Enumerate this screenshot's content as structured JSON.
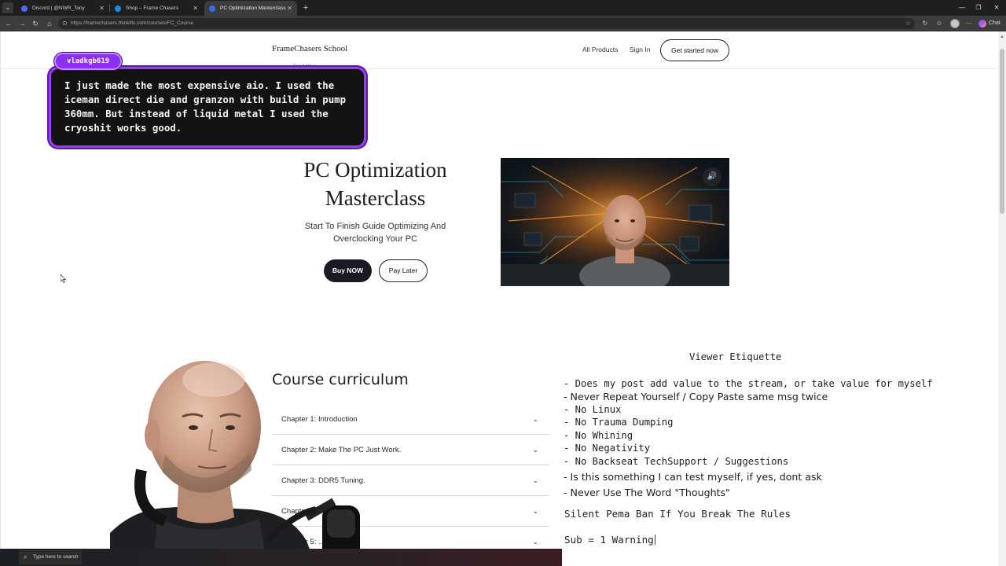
{
  "browser": {
    "tabs": [
      {
        "title": "Discord | @NWR_Tony",
        "favicon_color": "#5865F2"
      },
      {
        "title": "Shop – Frame Chasers",
        "favicon_color": "#1e88e5"
      },
      {
        "title": "PC Optimization Masterclass",
        "favicon_color": "#2f6fed"
      }
    ],
    "url": "https://framechasers.thinkific.com/courses/FC_Course",
    "copilot_label": "Chat"
  },
  "site": {
    "brand": "FrameChasers School",
    "nav": {
      "all_products": "All Products",
      "sign_in": "Sign In",
      "cta": "Get started now"
    },
    "read_more": "Read More"
  },
  "hero": {
    "title_line1": "PC Optimization",
    "title_line2": "Masterclass",
    "subtitle": "Start To Finish Guide Optimizing And Overclocking Your PC",
    "buy_label": "Buy NOW",
    "later_label": "Pay Later"
  },
  "curriculum": {
    "title": "Course curriculum",
    "chapters": [
      "Chapter 1: Introduction",
      "Chapter 2: Make The PC Just Work.",
      "Chapter 3: DDR5 Tuning.",
      "Chapter 4: ...ning",
      "Chapter 5: ..."
    ]
  },
  "chat": {
    "username": "vladkgb619",
    "message": "I just made the most expensive aio. I used the iceman direct die and granzon with build in pump 360mm. But instead of liquid metal I used the cryoshit works good.",
    "accent_color": "#9a3cf2"
  },
  "etiquette": {
    "title": "Viewer Etiquette",
    "rules": [
      "- Does my post add value to the stream, or take value for myself",
      "- Never Repeat Yourself / Copy Paste same msg twice",
      "- No Linux",
      "- No Trauma Dumping",
      "- No Whining",
      "- No Negativity",
      "- No Backseat TechSupport / Suggestions",
      "- Is this something I can test myself, if yes, dont ask",
      "- Never Use The Word \"Thoughts\""
    ],
    "ban_notice": "Silent Pema Ban If You Break The Rules",
    "sub_notice": "Sub = 1 Warning"
  },
  "taskbar": {
    "search_placeholder": "Type here to search"
  }
}
